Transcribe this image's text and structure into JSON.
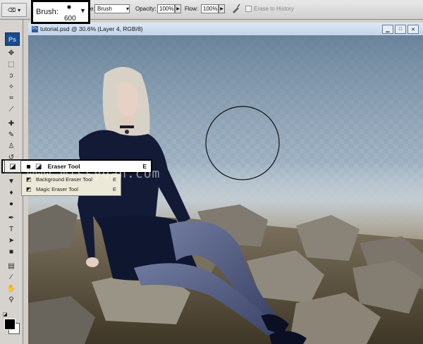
{
  "options_bar": {
    "brush_label": "Brush:",
    "brush_size": "600",
    "mode_label": "e:",
    "mode_value": "Brush",
    "opacity_label": "Opacity:",
    "opacity_value": "100%",
    "flow_label": "Flow:",
    "flow_value": "100%",
    "erase_history_label": "Erase to History"
  },
  "toolbox": {
    "logo": "Ps"
  },
  "document": {
    "title": "tutorial.psd @ 30.6% (Layer 4, RGB/8)"
  },
  "flyout": {
    "header_label": "Eraser Tool",
    "header_key": "E",
    "items": [
      {
        "label": "Background Eraser Tool",
        "key": "E"
      },
      {
        "label": "Magic Eraser Tool",
        "key": "E"
      }
    ]
  },
  "watermark": "www.missyuan.com",
  "colors": {
    "active_outline": "#000000",
    "sky": "#9fb2c3",
    "dress": "#121a36"
  }
}
